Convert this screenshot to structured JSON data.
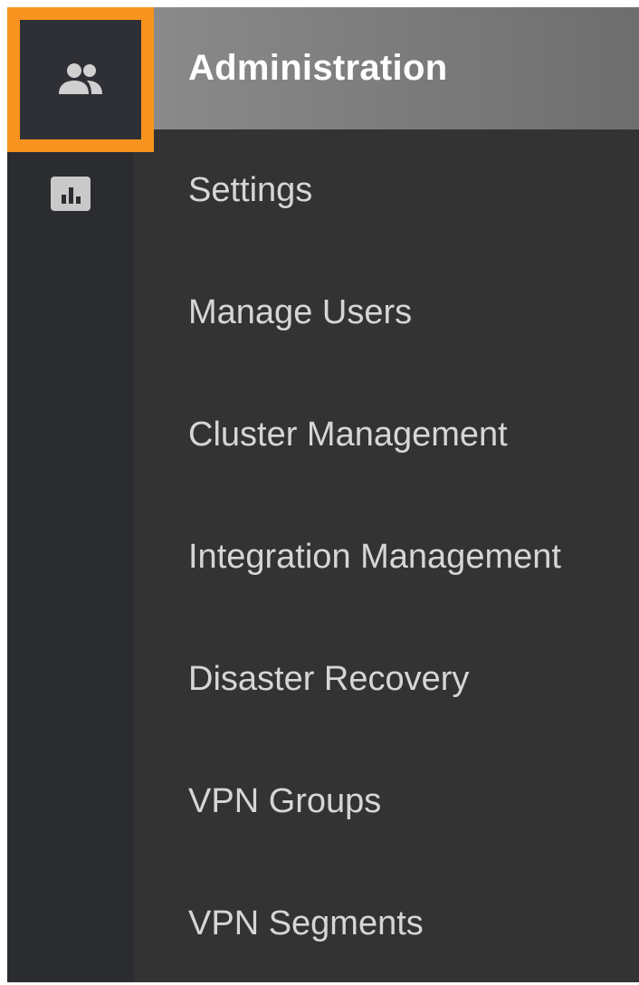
{
  "sidebar": {
    "rail": [
      {
        "icon": "people-icon",
        "selected": true
      },
      {
        "icon": "bar-chart-icon",
        "selected": false
      }
    ],
    "highlight_color": "#f7931e"
  },
  "menu": {
    "header": "Administration",
    "items": [
      {
        "label": "Settings"
      },
      {
        "label": "Manage Users"
      },
      {
        "label": "Cluster Management"
      },
      {
        "label": "Integration Management"
      },
      {
        "label": "Disaster Recovery"
      },
      {
        "label": "VPN Groups"
      },
      {
        "label": "VPN Segments"
      }
    ]
  }
}
